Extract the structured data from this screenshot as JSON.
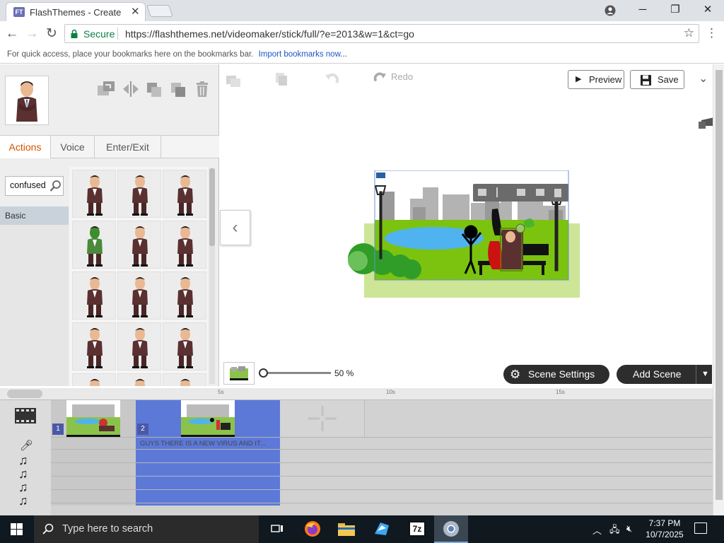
{
  "browser": {
    "tab_title": "FlashThemes - Create",
    "tab_favicon": "FT",
    "secure_label": "Secure",
    "url": "https://flashthemes.net/videomaker/stick/full/?e=2013&w=1&ct=go",
    "bookmarks_text": "For quick access, place your bookmarks here on the bookmarks bar.",
    "bookmarks_link": "Import bookmarks now..."
  },
  "toolbar": {
    "redo_label": "Redo",
    "preview_label": "Preview",
    "save_label": "Save"
  },
  "panel": {
    "tabs": [
      "Actions",
      "Voice",
      "Enter/Exit"
    ],
    "active_tab": "Actions",
    "search_value": "confused",
    "categories": [
      "Basic"
    ]
  },
  "zoom": {
    "value": "50 %"
  },
  "scene_actions": {
    "scene_settings": "Scene Settings",
    "add_scene": "Add Scene"
  },
  "timeline": {
    "ticks": [
      "5s",
      "10s",
      "15s"
    ],
    "scenes": [
      {
        "number": "1"
      },
      {
        "number": "2"
      }
    ],
    "speech_text": "GUYS THERE IS A NEW VIRUS AND IT..."
  },
  "taskbar": {
    "search_placeholder": "Type here to search",
    "time": "7:37 PM",
    "date": "10/7/2025"
  },
  "colors": {
    "accent_tab": "#d35400",
    "timeline_selected": "#5c79d8",
    "dark_button": "#2d2d2d"
  }
}
